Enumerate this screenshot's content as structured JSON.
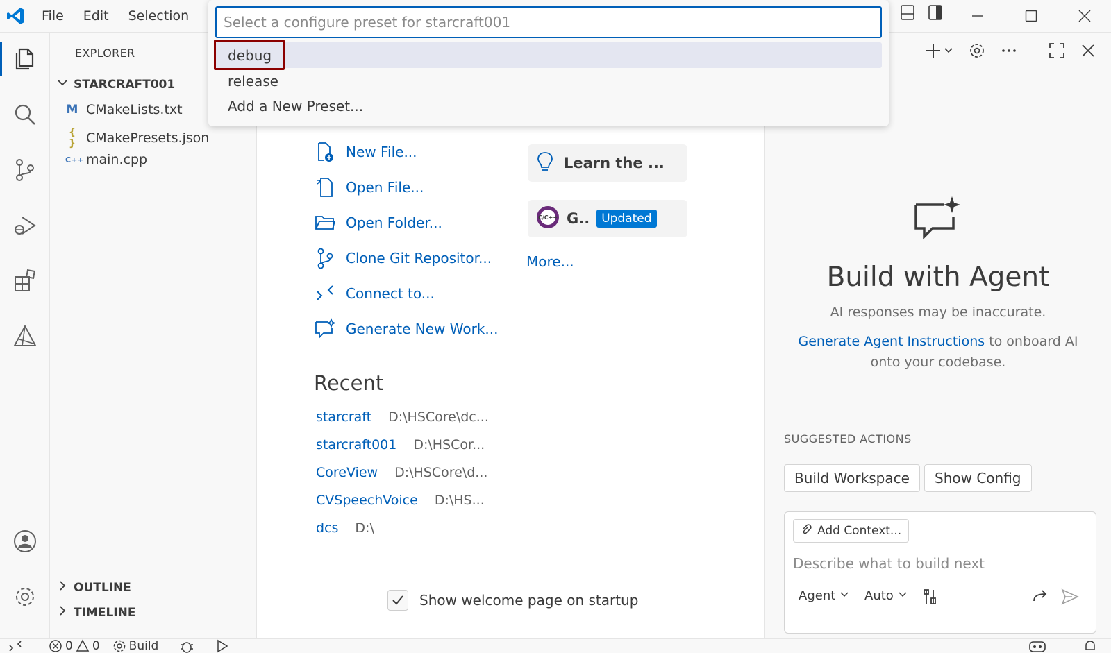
{
  "menu": {
    "file": "File",
    "edit": "Edit",
    "selection": "Selection"
  },
  "quickpick": {
    "placeholder": "Select a configure preset for starcraft001",
    "items": [
      "debug",
      "release",
      "Add a New Preset..."
    ]
  },
  "explorer": {
    "title": "EXPLORER",
    "root": "STARCRAFT001",
    "files": [
      {
        "name": "CMakeLists.txt",
        "icon": "M"
      },
      {
        "name": "CMakePresets.json",
        "icon": "{ }"
      },
      {
        "name": "main.cpp",
        "icon": "C++"
      }
    ],
    "outline": "OUTLINE",
    "timeline": "TIMELINE"
  },
  "welcome": {
    "start": [
      "New File...",
      "Open File...",
      "Open Folder...",
      "Clone Git Repositor...",
      "Connect to...",
      "Generate New Work..."
    ],
    "walkthroughs": {
      "learn": "Learn the ...",
      "cpp": "G..",
      "cpp_badge": "Updated",
      "more": "More..."
    },
    "recent_title": "Recent",
    "recent": [
      {
        "name": "starcraft",
        "path": "D:\\HSCore\\dc..."
      },
      {
        "name": "starcraft001",
        "path": "D:\\HSCor..."
      },
      {
        "name": "CoreView",
        "path": "D:\\HSCore\\d..."
      },
      {
        "name": "CVSpeechVoice",
        "path": "D:\\HS..."
      },
      {
        "name": "dcs",
        "path": "D:\\"
      }
    ],
    "show_on_startup": "Show welcome page on startup"
  },
  "chat": {
    "title": "Build with Agent",
    "subtitle": "AI responses may be inaccurate.",
    "link": "Generate Agent Instructions",
    "desc_rest": " to onboard AI onto your codebase.",
    "suggested_title": "SUGGESTED ACTIONS",
    "suggested": [
      "Build Workspace",
      "Show Config"
    ],
    "add_context": "Add Context...",
    "input_placeholder": "Describe what to build next",
    "mode": "Agent",
    "model": "Auto"
  },
  "status": {
    "errors": "0",
    "warnings": "0",
    "build": "Build"
  },
  "colors": {
    "accent": "#005fb8",
    "badge": "#0078d4",
    "highlight": "#8b0000"
  }
}
